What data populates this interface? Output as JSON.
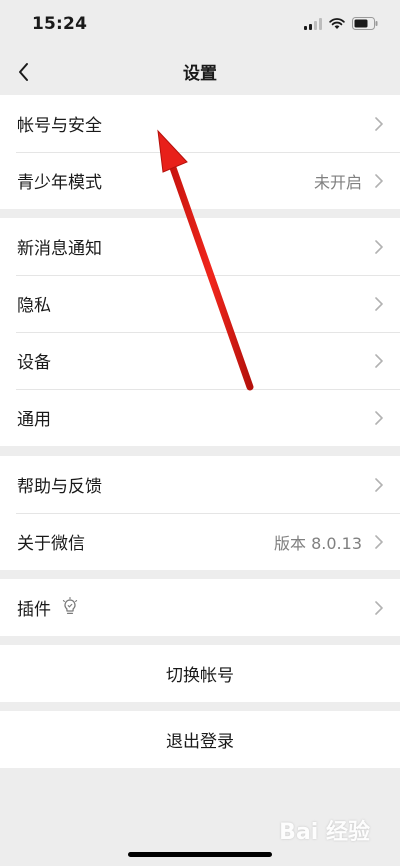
{
  "status_bar": {
    "time": "15:24",
    "icons": [
      "signal-icon",
      "wifi-icon",
      "battery-icon"
    ]
  },
  "nav": {
    "title": "设置",
    "back_icon": "chevron-left-icon"
  },
  "groups": [
    {
      "items": [
        {
          "label": "帐号与安全",
          "value": ""
        },
        {
          "label": "青少年模式",
          "value": "未开启"
        }
      ]
    },
    {
      "items": [
        {
          "label": "新消息通知",
          "value": ""
        },
        {
          "label": "隐私",
          "value": ""
        },
        {
          "label": "设备",
          "value": ""
        },
        {
          "label": "通用",
          "value": ""
        }
      ]
    },
    {
      "items": [
        {
          "label": "帮助与反馈",
          "value": ""
        },
        {
          "label": "关于微信",
          "value": "版本 8.0.13"
        }
      ]
    },
    {
      "items": [
        {
          "label": "插件",
          "value": "",
          "icon": "lightbulb-icon"
        }
      ]
    }
  ],
  "actions": {
    "switch_account": "切换帐号",
    "logout": "退出登录"
  },
  "annotation_arrow": {
    "color": "#e8201a"
  },
  "watermark": {
    "text": "Bai 经验"
  },
  "colors": {
    "background": "#ededed",
    "cell": "#ffffff",
    "secondary_text": "#808080",
    "chevron": "#b2b2b2"
  }
}
